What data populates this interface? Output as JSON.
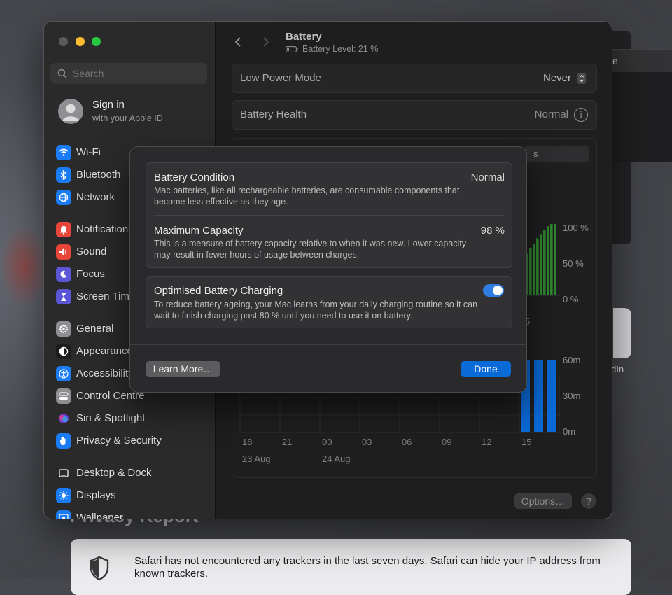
{
  "window": {
    "title": "Battery",
    "subtitle": "Battery Level: 21 %"
  },
  "search": {
    "placeholder": "Search"
  },
  "account": {
    "title": "Sign in",
    "subtitle": "with your Apple ID"
  },
  "sidebar": {
    "items": [
      {
        "label": "Wi-Fi",
        "icon": "wifi-icon",
        "color": "#1a7cf5"
      },
      {
        "label": "Bluetooth",
        "icon": "bluetooth-icon",
        "color": "#1a7cf5"
      },
      {
        "label": "Network",
        "icon": "globe-icon",
        "color": "#1a7cf5"
      },
      {
        "label": "Notifications",
        "icon": "bell-icon",
        "color": "#e9463b"
      },
      {
        "label": "Sound",
        "icon": "speaker-icon",
        "color": "#e9463b"
      },
      {
        "label": "Focus",
        "icon": "moon-icon",
        "color": "#5b56d6"
      },
      {
        "label": "Screen Time",
        "icon": "hourglass-icon",
        "color": "#5b56d6"
      },
      {
        "label": "General",
        "icon": "gear-icon",
        "color": "#8e8e93"
      },
      {
        "label": "Appearance",
        "icon": "appearance-icon",
        "color": "#1c1c1e"
      },
      {
        "label": "Accessibility",
        "icon": "accessibility-icon",
        "color": "#1a7cf5"
      },
      {
        "label": "Control Centre",
        "icon": "control-centre-icon",
        "color": "#8e8e93"
      },
      {
        "label": "Siri & Spotlight",
        "icon": "siri-icon",
        "color": "#2a2a2a"
      },
      {
        "label": "Privacy & Security",
        "icon": "hand-icon",
        "color": "#1a7cf5"
      },
      {
        "label": "Desktop & Dock",
        "icon": "dock-icon",
        "color": "#2a2a2a"
      },
      {
        "label": "Displays",
        "icon": "sun-icon",
        "color": "#1a7cf5"
      },
      {
        "label": "Wallpaper",
        "icon": "wallpaper-icon",
        "color": "#1a7cf5"
      }
    ]
  },
  "settings": {
    "low_power_mode": {
      "label": "Low Power Mode",
      "value": "Never"
    },
    "battery_health": {
      "label": "Battery Health",
      "value": "Normal"
    }
  },
  "chart": {
    "tab_fragment": "s",
    "pct_labels": [
      "100 %",
      "50 %",
      "0 %"
    ],
    "min_labels": [
      "60m",
      "30m",
      "0m"
    ],
    "x_labels": [
      "18",
      "21",
      "00",
      "03",
      "06",
      "09",
      "12",
      "15"
    ],
    "partial_x_label": "5",
    "date_labels": [
      "23 Aug",
      "24 Aug"
    ],
    "battery_bar_levels": [
      0.52,
      0.58,
      0.66,
      0.72,
      0.8,
      0.86,
      0.92,
      0.97,
      1.0,
      1.0
    ],
    "usage_bar_levels": [
      1.0,
      1.0,
      1.0
    ],
    "colors": {
      "battery": "#2f8a2f",
      "usage": "#0a6ad8"
    }
  },
  "footer": {
    "options_label": "Options…",
    "help_label": "?"
  },
  "sheet": {
    "battery_condition": {
      "title": "Battery Condition",
      "value": "Normal",
      "desc": "Mac batteries, like all rechargeable batteries, are consumable components that become less effective as they age."
    },
    "maximum_capacity": {
      "title": "Maximum Capacity",
      "value": "98 %",
      "desc": "This is a measure of battery capacity relative to when it was new. Lower capacity may result in fewer hours of usage between charges."
    },
    "optimised_charging": {
      "title": "Optimised Battery Charging",
      "enabled": true,
      "desc": "To reduce battery ageing, your Mac learns from your daily charging routine so it can wait to finish charging past 80 % until you need to use it on battery."
    },
    "learn_more_label": "Learn More…",
    "done_label": "Done"
  },
  "background": {
    "menu_fragment": "e",
    "card_fragment": "dIn",
    "privacy_title": "Privacy Report",
    "privacy_text": "Safari has not encountered any trackers in the last seven days. Safari can hide your IP address from known trackers."
  }
}
